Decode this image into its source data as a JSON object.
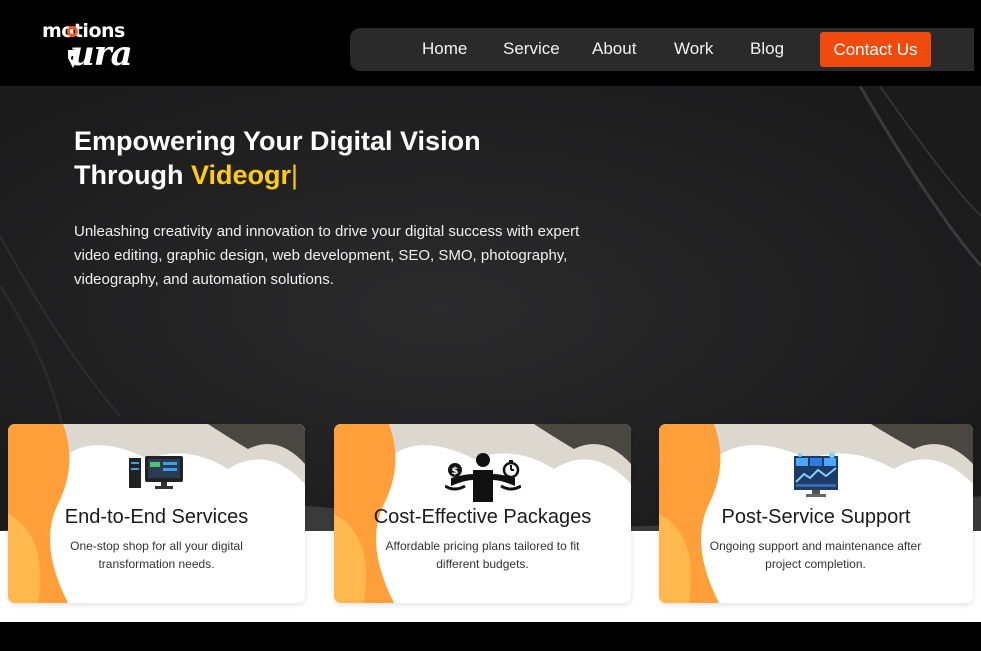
{
  "brand": {
    "logo_top": "motions",
    "logo_bottom": "ura"
  },
  "nav": {
    "items": [
      {
        "label": "Home",
        "name": "nav-home"
      },
      {
        "label": "Service",
        "name": "nav-service"
      },
      {
        "label": "About",
        "name": "nav-about"
      },
      {
        "label": "Work",
        "name": "nav-work"
      },
      {
        "label": "Blog",
        "name": "nav-blog"
      }
    ],
    "contact_label": "Contact Us"
  },
  "hero": {
    "title_line1": "Empowering Your Digital Vision",
    "title_line2_prefix": "Through ",
    "title_highlight": "Videogr",
    "cursor": "|",
    "description": "Unleashing creativity and innovation to drive your digital success with expert video editing, graphic design, web development, SEO, SMO, photography, videography, and automation solutions."
  },
  "cards": [
    {
      "title": "End-to-End Services",
      "description": "One-stop shop for all your digital transformation needs.",
      "icon": "computer-setup-icon"
    },
    {
      "title": "Cost-Effective Packages",
      "description": "Affordable pricing plans tailored to fit different budgets.",
      "icon": "balance-money-time-icon"
    },
    {
      "title": "Post-Service Support",
      "description": "Ongoing support and maintenance after project completion.",
      "icon": "dashboard-screen-icon"
    }
  ],
  "colors": {
    "accent_orange": "#f04a0e",
    "highlight_yellow": "#ffcc12",
    "hero_bg": "#1f1f20",
    "card_orange": "#ff9f3a"
  }
}
